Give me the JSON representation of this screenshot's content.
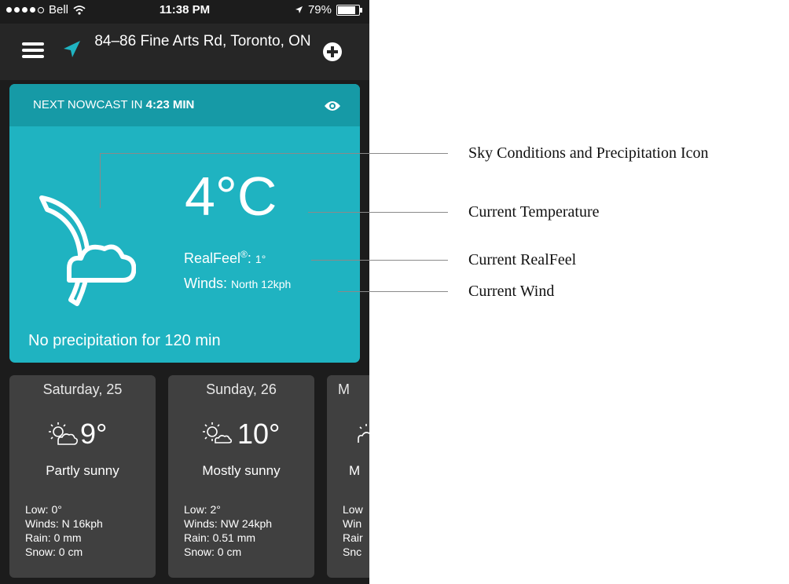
{
  "status_bar": {
    "carrier": "Bell",
    "time": "11:38 PM",
    "battery": "79%"
  },
  "header": {
    "location": "84–86 Fine Arts Rd, Toronto, ON"
  },
  "nowcast": {
    "next_label": "NEXT NOWCAST IN",
    "next_time": "4:23 MIN",
    "temperature": "4°C",
    "realfeel_label": "RealFeel",
    "realfeel_mark": "®",
    "realfeel_sep": ":",
    "realfeel_value": "1°",
    "winds_label": "Winds:",
    "winds_value": "North 12kph",
    "precip_text": "No precipitation for 120 min",
    "colors": {
      "card": "#1fb3c1",
      "card_header": "#169aa6"
    }
  },
  "forecast": [
    {
      "day": "Saturday, 25",
      "temp": "9°",
      "condition": "Partly sunny",
      "low": "Low: 0°",
      "winds": "Winds: N 16kph",
      "rain": "Rain: 0 mm",
      "snow": "Snow: 0 cm"
    },
    {
      "day": "Sunday, 26",
      "temp": "10°",
      "condition": "Mostly sunny",
      "low": "Low: 2°",
      "winds": "Winds: NW 24kph",
      "rain": "Rain: 0.51 mm",
      "snow": "Snow: 0 cm"
    },
    {
      "day": "M",
      "temp": "",
      "condition": "M",
      "low": "Low",
      "winds": "Win",
      "rain": "Rair",
      "snow": "Snc"
    }
  ],
  "annotations": {
    "sky": "Sky Conditions and Precipitation Icon",
    "temp": "Current Temperature",
    "realfeel": "Current RealFeel",
    "wind": "Current Wind"
  },
  "icons": [
    "hamburger-icon",
    "location-arrow-icon",
    "add-icon",
    "eye-icon",
    "moon-cloud-icon",
    "partly-sunny-icon",
    "mostly-sunny-icon"
  ]
}
